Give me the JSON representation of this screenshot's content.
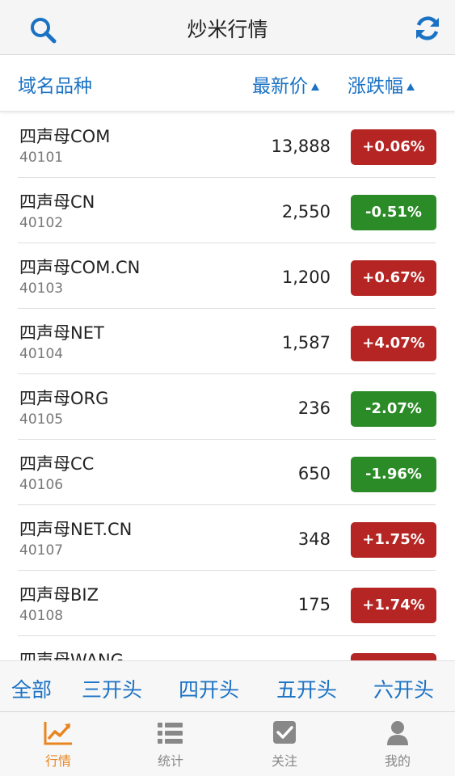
{
  "header": {
    "title": "炒米行情"
  },
  "columns": {
    "name": "域名品种",
    "price": "最新价",
    "change": "涨跌幅"
  },
  "rows": [
    {
      "name": "四声母COM",
      "code": "40101",
      "price": "13,888",
      "change": "+0.06%",
      "dir": "up"
    },
    {
      "name": "四声母CN",
      "code": "40102",
      "price": "2,550",
      "change": "-0.51%",
      "dir": "down"
    },
    {
      "name": "四声母COM.CN",
      "code": "40103",
      "price": "1,200",
      "change": "+0.67%",
      "dir": "up"
    },
    {
      "name": "四声母NET",
      "code": "40104",
      "price": "1,587",
      "change": "+4.07%",
      "dir": "up"
    },
    {
      "name": "四声母ORG",
      "code": "40105",
      "price": "236",
      "change": "-2.07%",
      "dir": "down"
    },
    {
      "name": "四声母CC",
      "code": "40106",
      "price": "650",
      "change": "-1.96%",
      "dir": "down"
    },
    {
      "name": "四声母NET.CN",
      "code": "40107",
      "price": "348",
      "change": "+1.75%",
      "dir": "up"
    },
    {
      "name": "四声母BIZ",
      "code": "40108",
      "price": "175",
      "change": "+1.74%",
      "dir": "up"
    },
    {
      "name": "四声母WANG",
      "code": "",
      "price": "",
      "change": "",
      "dir": "up"
    }
  ],
  "filters": [
    "全部",
    "三开头",
    "四开头",
    "五开头",
    "六开头"
  ],
  "tabs": [
    {
      "label": "行情",
      "icon": "chart-icon",
      "active": true
    },
    {
      "label": "统计",
      "icon": "list-icon",
      "active": false
    },
    {
      "label": "关注",
      "icon": "checkbox-icon",
      "active": false
    },
    {
      "label": "我的",
      "icon": "user-icon",
      "active": false
    }
  ],
  "colors": {
    "accent": "#1a72c4",
    "up": "#b42523",
    "down": "#2b8b27",
    "active_tab": "#e8851f"
  }
}
